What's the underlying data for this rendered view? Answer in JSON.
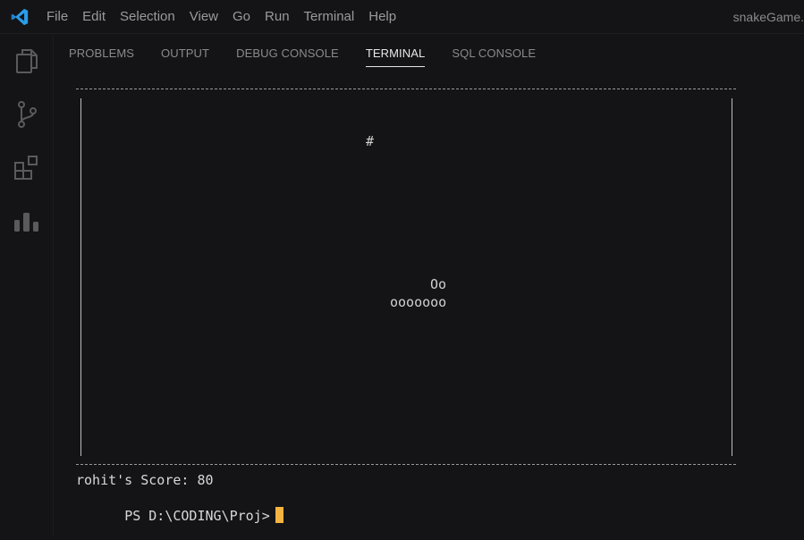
{
  "menu": [
    "File",
    "Edit",
    "Selection",
    "View",
    "Go",
    "Run",
    "Terminal",
    "Help"
  ],
  "window_title": "snakeGame.",
  "colors": {
    "vscode_blue": "#2b9ce8",
    "cursor": "#f5b342",
    "icon": "#5a5a5e"
  },
  "activity_icons": [
    "explorer-icon",
    "source-control-icon",
    "extensions-icon",
    "charts-icon"
  ],
  "panel": {
    "tabs": [
      "PROBLEMS",
      "OUTPUT",
      "DEBUG CONSOLE",
      "TERMINAL",
      "SQL CONSOLE"
    ],
    "active_tab": "TERMINAL"
  },
  "terminal": {
    "food": "#",
    "snake_head": "Oo",
    "snake_body": "ooooooo",
    "score_text": "rohit's Score: 80",
    "prompt": "PS D:\\CODING\\Proj>"
  }
}
